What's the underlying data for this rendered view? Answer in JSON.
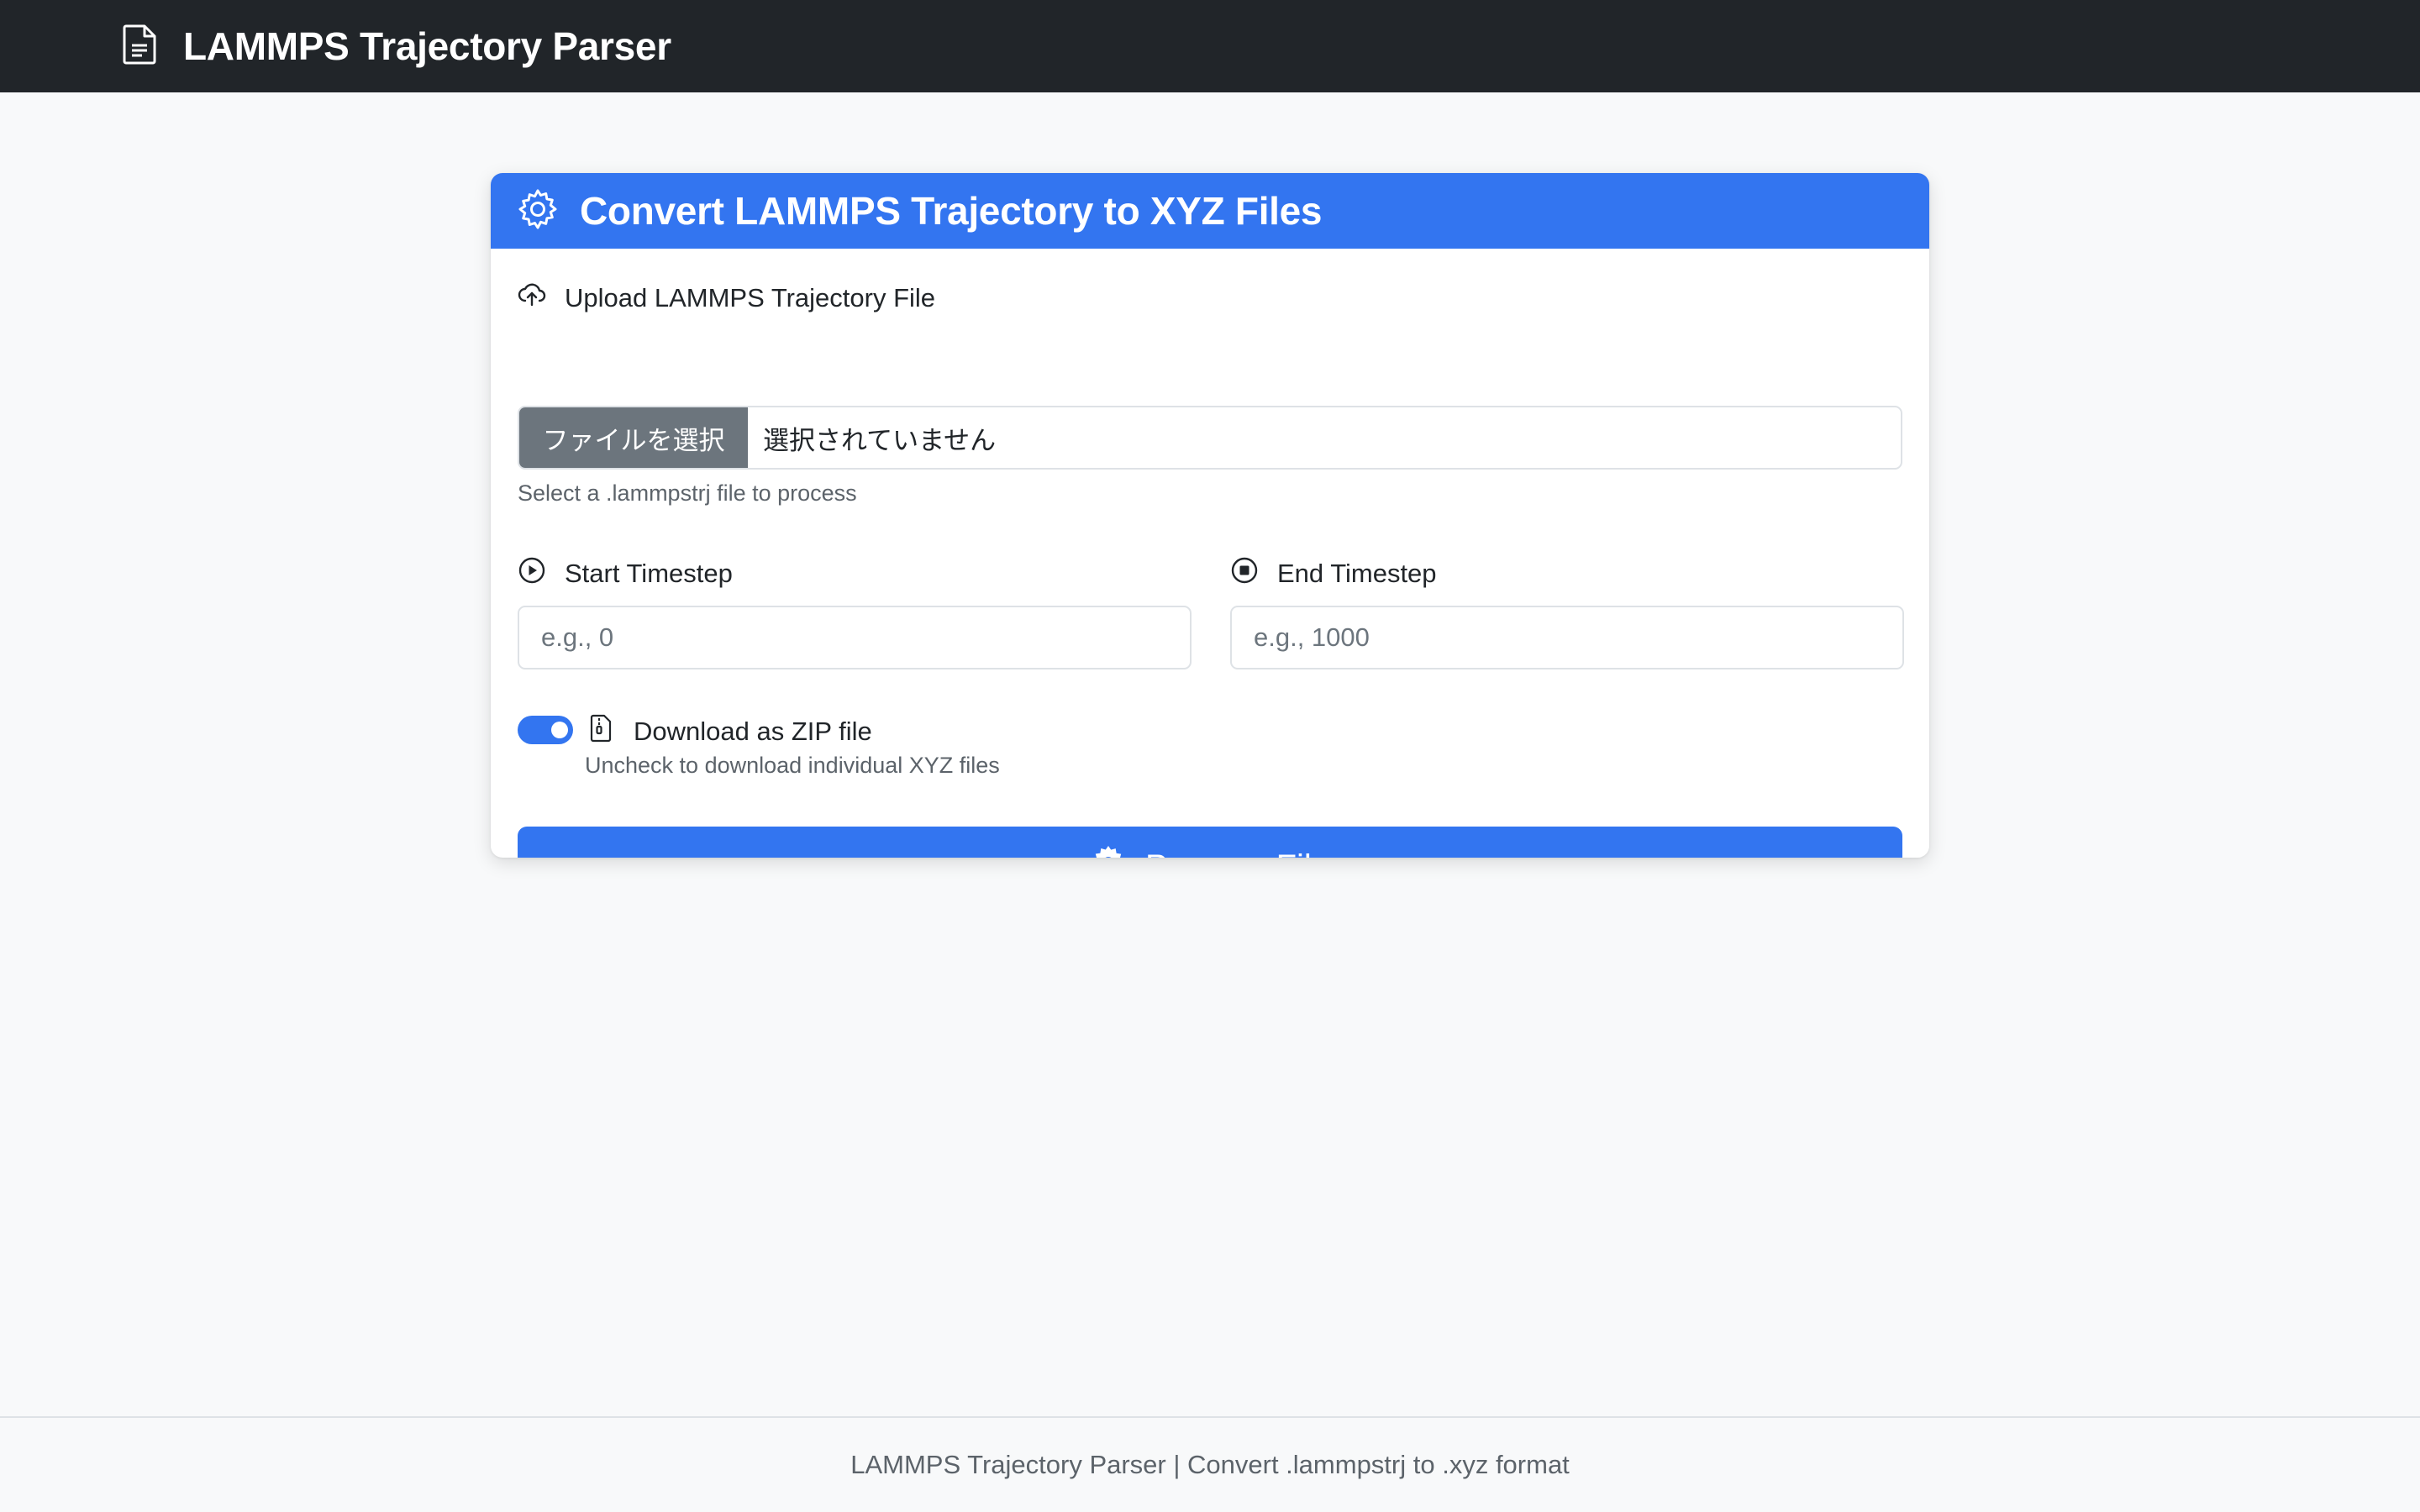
{
  "navbar": {
    "brand": "LAMMPS Trajectory Parser",
    "icon": "file-text-icon"
  },
  "card": {
    "title": "Convert LAMMPS Trajectory to XYZ Files",
    "icon": "gear-icon"
  },
  "upload": {
    "label": "Upload LAMMPS Trajectory File",
    "choose_button": "ファイルを選択",
    "status": "選択されていません",
    "help": "Select a .lammpstrj file to process"
  },
  "start": {
    "label": "Start Timestep",
    "placeholder": "e.g., 0"
  },
  "end": {
    "label": "End Timestep",
    "placeholder": "e.g., 1000"
  },
  "zip": {
    "label": "Download as ZIP file",
    "help": "Uncheck to download individual XYZ files",
    "checked": true
  },
  "process_button": "Process File",
  "footer": "LAMMPS Trajectory Parser | Convert .lammpstrj to .xyz format",
  "colors": {
    "primary": "#3375f0",
    "navbar": "#212529",
    "secondary": "#6c757d",
    "background": "#f8f9fa"
  }
}
